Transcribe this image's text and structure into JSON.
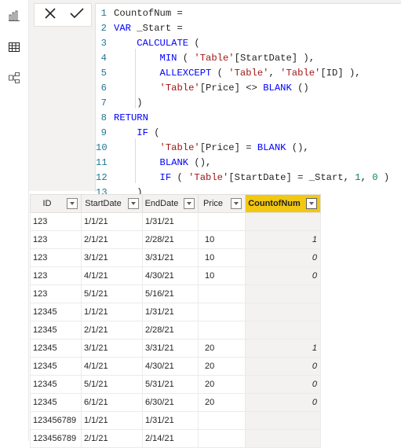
{
  "left_rail": {
    "icons": [
      "report-view-icon",
      "data-view-icon",
      "model-view-icon"
    ]
  },
  "formula_bar": {
    "cancel_icon": "close-icon",
    "commit_icon": "checkmark-icon",
    "lines": [
      {
        "num": "1",
        "text": "CountofNum ="
      },
      {
        "num": "2",
        "text": "VAR _Start ="
      },
      {
        "num": "3",
        "text": "    CALCULATE ("
      },
      {
        "num": "4",
        "text": "        MIN ( 'Table'[StartDate] ),"
      },
      {
        "num": "5",
        "text": "        ALLEXCEPT ( 'Table', 'Table'[ID] ),"
      },
      {
        "num": "6",
        "text": "        'Table'[Price] <> BLANK ()"
      },
      {
        "num": "7",
        "text": "    )"
      },
      {
        "num": "8",
        "text": "RETURN"
      },
      {
        "num": "9",
        "text": "    IF ("
      },
      {
        "num": "10",
        "text": "        'Table'[Price] = BLANK (),"
      },
      {
        "num": "11",
        "text": "        BLANK (),"
      },
      {
        "num": "12",
        "text": "        IF ( 'Table'[StartDate] = _Start, 1, 0 )"
      },
      {
        "num": "13",
        "text": "    )"
      }
    ]
  },
  "table": {
    "columns": [
      "ID",
      "StartDate",
      "EndDate",
      "Price",
      "CountofNum"
    ],
    "selected_column": "CountofNum",
    "rows": [
      [
        "123",
        "1/1/21",
        "1/31/21",
        "",
        ""
      ],
      [
        "123",
        "2/1/21",
        "2/28/21",
        "10",
        "1"
      ],
      [
        "123",
        "3/1/21",
        "3/31/21",
        "10",
        "0"
      ],
      [
        "123",
        "4/1/21",
        "4/30/21",
        "10",
        "0"
      ],
      [
        "123",
        "5/1/21",
        "5/16/21",
        "",
        ""
      ],
      [
        "12345",
        "1/1/21",
        "1/31/21",
        "",
        ""
      ],
      [
        "12345",
        "2/1/21",
        "2/28/21",
        "",
        ""
      ],
      [
        "12345",
        "3/1/21",
        "3/31/21",
        "20",
        "1"
      ],
      [
        "12345",
        "4/1/21",
        "4/30/21",
        "20",
        "0"
      ],
      [
        "12345",
        "5/1/21",
        "5/31/21",
        "20",
        "0"
      ],
      [
        "12345",
        "6/1/21",
        "6/30/21",
        "20",
        "0"
      ],
      [
        "123456789",
        "1/1/21",
        "1/31/21",
        "",
        ""
      ],
      [
        "123456789",
        "2/1/21",
        "2/14/21",
        "",
        ""
      ]
    ]
  },
  "colors": {
    "selected_header": "#f2c811",
    "line_number": "#237893",
    "keyword": "#0000ff",
    "string": "#a31515",
    "number": "#098658"
  }
}
